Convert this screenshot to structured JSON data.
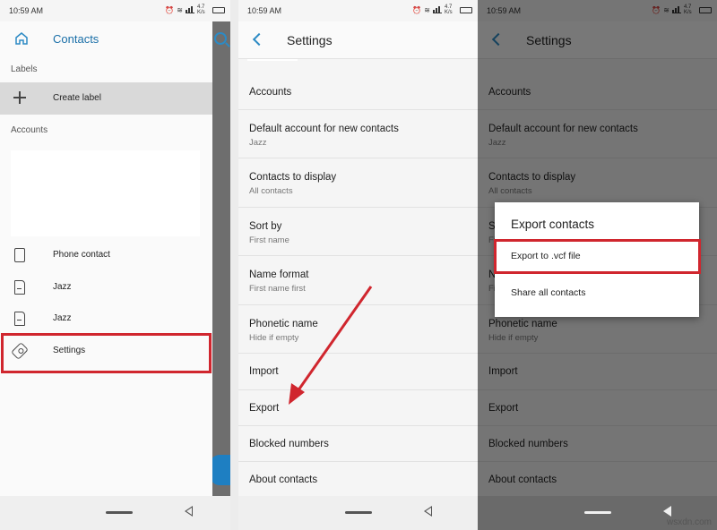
{
  "status_bar": {
    "time": "10:59 AM",
    "speed": "4.7 K/s"
  },
  "drawer": {
    "title": "Contacts",
    "labels_section": "Labels",
    "create_label": "Create label",
    "accounts_section": "Accounts",
    "items": [
      {
        "label": "Phone contact",
        "icon": "phone-icon"
      },
      {
        "label": "Jazz",
        "icon": "sim-card-icon"
      },
      {
        "label": "Jazz",
        "icon": "sim-card-icon"
      },
      {
        "label": "Settings",
        "icon": "gear-icon"
      }
    ]
  },
  "settings": {
    "title": "Settings",
    "rows": [
      {
        "title": "Accounts",
        "subtitle": ""
      },
      {
        "title": "Default account for new contacts",
        "subtitle": "Jazz"
      },
      {
        "title": "Contacts to display",
        "subtitle": "All contacts"
      },
      {
        "title": "Sort by",
        "subtitle": "First name"
      },
      {
        "title": "Name format",
        "subtitle": "First name first"
      },
      {
        "title": "Phonetic name",
        "subtitle": "Hide if empty"
      },
      {
        "title": "Import",
        "subtitle": ""
      },
      {
        "title": "Export",
        "subtitle": ""
      },
      {
        "title": "Blocked numbers",
        "subtitle": ""
      },
      {
        "title": "About contacts",
        "subtitle": ""
      }
    ]
  },
  "dialog": {
    "title": "Export contacts",
    "options": [
      "Export to .vcf file",
      "Share all contacts"
    ]
  },
  "watermark": "wsxdn.com",
  "colors": {
    "accent": "#2c8ac4",
    "highlight": "#d0262e"
  }
}
